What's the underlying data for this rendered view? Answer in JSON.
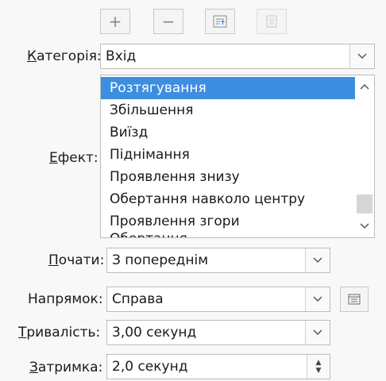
{
  "toolbar": {
    "add_label": "+",
    "remove_label": "−",
    "icons": [
      "plus-icon",
      "minus-icon",
      "move-up-icon",
      "move-down-icon"
    ]
  },
  "category": {
    "label_prefix": "К",
    "label_rest": "атегорія:",
    "value": "Вхід"
  },
  "effect": {
    "label_prefix": "Е",
    "label_rest": "фект:",
    "items": [
      "Розтягування",
      "Збільшення",
      "Виїзд",
      "Піднімання",
      "Проявлення знизу",
      "Обертання навколо центру",
      "Проявлення згори",
      "Обертання"
    ],
    "selected": 0
  },
  "start": {
    "label_prefix": "П",
    "label_rest": "очати:",
    "value": "З попереднім"
  },
  "direction": {
    "label": "Напрямок:",
    "value": "Справа"
  },
  "duration": {
    "label_prefix": "Т",
    "label_rest": "ривалість:",
    "value": "3,00 секунд"
  },
  "delay": {
    "label_prefix": "З",
    "label_rest": "атримка:",
    "value": "2,0 секунд"
  },
  "colors": {
    "selection": "#3d8ee0",
    "border": "#bcbcbc"
  }
}
